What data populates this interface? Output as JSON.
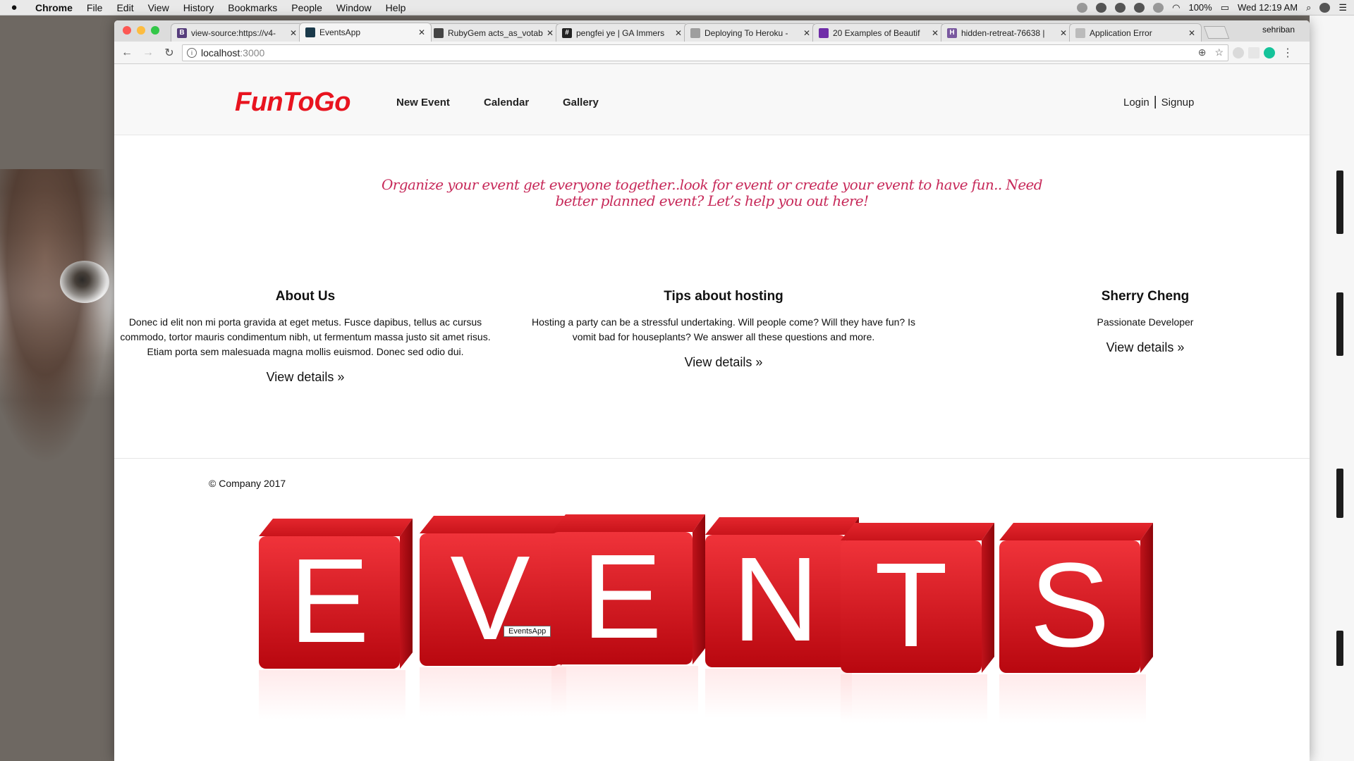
{
  "menubar": {
    "app": "Chrome",
    "items": [
      "File",
      "Edit",
      "View",
      "History",
      "Bookmarks",
      "People",
      "Window",
      "Help"
    ],
    "battery": "100%",
    "clock": "Wed 12:19 AM"
  },
  "browser": {
    "profile_name": "sehriban",
    "profile_name_2": "sehriban",
    "tabs": [
      {
        "title": "view-source:https://v4-",
        "favicon": "B",
        "favcolor": "#563d7c"
      },
      {
        "title": "EventsApp",
        "favicon": "",
        "favcolor": "#1b3a4b"
      },
      {
        "title": "RubyGem acts_as_votab",
        "favicon": "",
        "favcolor": "#444444"
      },
      {
        "title": "pengfei ye | GA Immers",
        "favicon": "#",
        "favcolor": "#222222"
      },
      {
        "title": "Deploying To Heroku - ",
        "favicon": "",
        "favcolor": "#9e9e9e"
      },
      {
        "title": "20 Examples of Beautif",
        "favicon": "",
        "favcolor": "#6f2da8"
      },
      {
        "title": "hidden-retreat-76638 |",
        "favicon": "H",
        "favcolor": "#79589f"
      },
      {
        "title": "Application Error",
        "favicon": "",
        "favcolor": "#bbbbbb"
      }
    ],
    "url_host": "localhost",
    "url_port": ":3000"
  },
  "site": {
    "brand": "FunToGo",
    "nav": {
      "new_event": "New Event",
      "calendar": "Calendar",
      "gallery": "Gallery"
    },
    "auth": {
      "login": "Login",
      "sep": "|",
      "signup": "Signup"
    },
    "hero": "Organize your event get everyone together..look for event or create your event to have fun.. Need better planned event? Let’s help you out here!",
    "columns": [
      {
        "heading": "About Us",
        "body": "Donec id elit non mi porta gravida at eget metus. Fusce dapibus, tellus ac cursus commodo, tortor mauris condimentum nibh, ut fermentum massa justo sit amet risus. Etiam porta sem malesuada magna mollis euismod. Donec sed odio dui.",
        "button": "View details »"
      },
      {
        "heading": "Tips about hosting",
        "body": "Hosting a party can be a stressful undertaking. Will people come? Will they have fun? Is vomit bad for houseplants? We answer all these questions and more.",
        "button": "View details »"
      },
      {
        "heading": "Sherry Cheng",
        "body": "Passionate Developer",
        "button": "View details »"
      }
    ],
    "footer": "© Company 2017",
    "tooltip": "EventsApp",
    "events_letters": [
      "E",
      "V",
      "E",
      "N",
      "T",
      "S"
    ]
  }
}
